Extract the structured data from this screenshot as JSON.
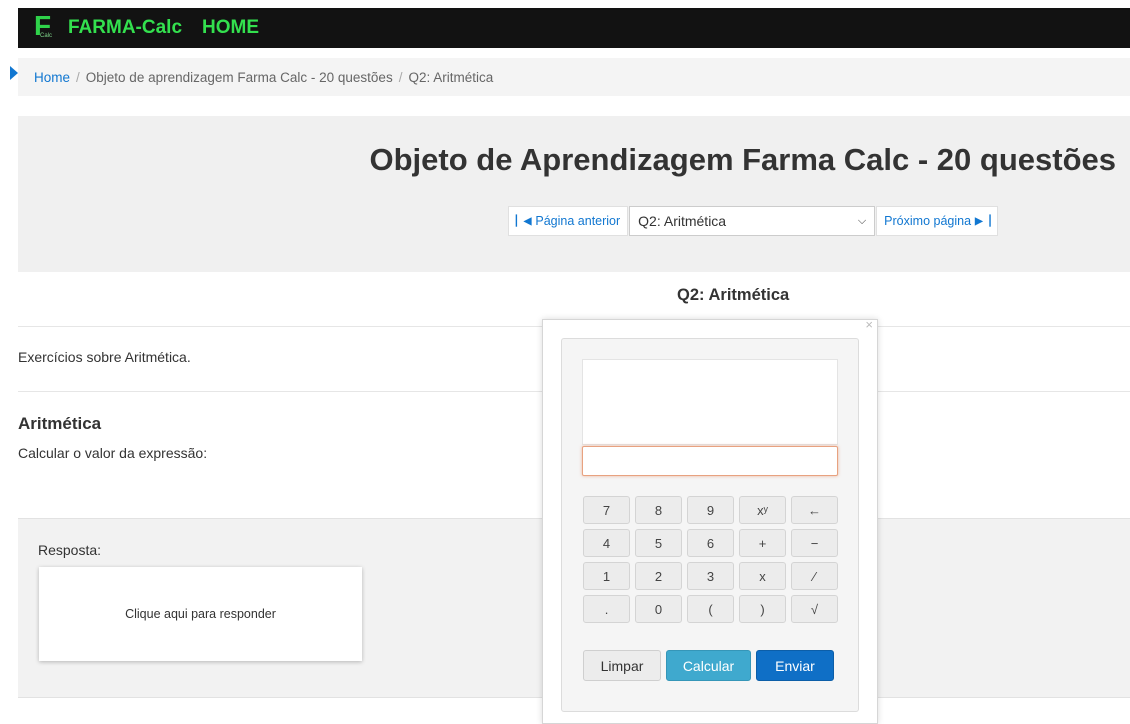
{
  "navbar": {
    "logo_letter": "F",
    "logo_sub": "Calc",
    "brand": "FARMA-Calc",
    "home": "HOME"
  },
  "breadcrumb": {
    "home": "Home",
    "separator": "/",
    "items": [
      "Objeto de aprendizagem Farma Calc - 20 questões",
      "Q2: Aritmética"
    ]
  },
  "header": {
    "title": "Objeto de Aprendizagem Farma Calc - 20 questões",
    "prev_label": "Página anterior",
    "next_label": "Próximo página",
    "select_value": "Q2: Aritmética"
  },
  "content": {
    "question_heading": "Q2: Aritmética",
    "intro": "Exercícios sobre Aritmética.",
    "section_title": "Aritmética",
    "section_text": "Calcular o valor da expressão:"
  },
  "answer": {
    "label": "Resposta:",
    "card_text": "Clique aqui para responder"
  },
  "calculator": {
    "close": "×",
    "input_value": "",
    "keys": [
      "7",
      "8",
      "9",
      "xʸ",
      "←",
      "4",
      "5",
      "6",
      "+",
      "−",
      "1",
      "2",
      "3",
      "x",
      "∕",
      ".",
      "0",
      "(",
      ")",
      "√"
    ],
    "clear_label": "Limpar",
    "calc_label": "Calcular",
    "send_label": "Enviar"
  },
  "colors": {
    "navbar_bg": "#121212",
    "brand_green": "#33e04e",
    "link_blue": "#1177d1",
    "calc_button": "#3fa9ce",
    "send_button": "#0f6fc6"
  }
}
